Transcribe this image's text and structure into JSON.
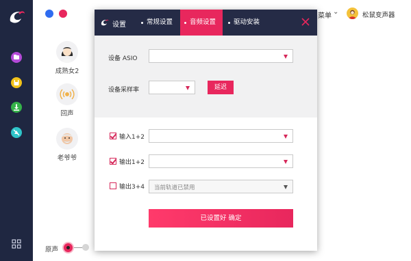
{
  "app": {
    "menu_label": "菜单",
    "user_name": "松鼠变声器"
  },
  "window_buttons": {
    "colors": [
      "#2f6cf0",
      "#e8275d"
    ]
  },
  "sidebar": {
    "icons": [
      {
        "name": "folder-icon",
        "color": "#b44bd8"
      },
      {
        "name": "save-icon",
        "color": "#f2c21a"
      },
      {
        "name": "download-icon",
        "color": "#35b34a"
      },
      {
        "name": "bell-off-icon",
        "color": "#2fc4c9"
      }
    ]
  },
  "voices": [
    {
      "label": "成熟女2",
      "icon": "woman-avatar-icon"
    },
    {
      "label": "回声",
      "icon": "echo-icon"
    },
    {
      "label": "老爷爷",
      "icon": "old-man-avatar-icon"
    }
  ],
  "bottom": {
    "original_label": "原声"
  },
  "dialog": {
    "title": "设置",
    "tabs": [
      {
        "label": "常规设置",
        "active": false
      },
      {
        "label": "音频设置",
        "active": true
      },
      {
        "label": "驱动安装",
        "active": false
      }
    ],
    "device_asio_label": "设备 ASIO",
    "device_asio_value": "",
    "sample_rate_label": "设备采样率",
    "sample_rate_value": "",
    "delay_button": "延迟",
    "input_label": "输入1+2",
    "input_checked": true,
    "input_value": "",
    "output12_label": "输出1+2",
    "output12_checked": true,
    "output12_value": "",
    "output34_label": "输出3+4",
    "output34_checked": false,
    "output34_value": "当前轨道已禁用",
    "confirm_button": "已设置好 确定",
    "accent_color": "#e8275d"
  }
}
